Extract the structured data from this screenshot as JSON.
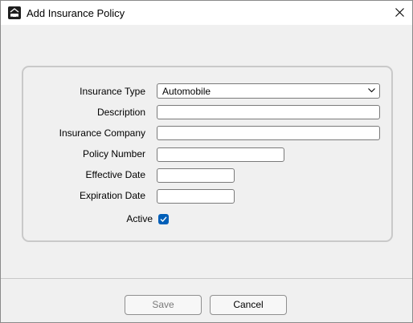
{
  "window": {
    "title": "Add Insurance Policy",
    "app_icon": "car-key-icon",
    "close_icon": "close-icon"
  },
  "form": {
    "insurance_type": {
      "label": "Insurance Type",
      "value": "Automobile"
    },
    "description": {
      "label": "Description",
      "value": ""
    },
    "insurance_company": {
      "label": "Insurance Company",
      "value": ""
    },
    "policy_number": {
      "label": "Policy Number",
      "value": ""
    },
    "effective_date": {
      "label": "Effective Date",
      "value": ""
    },
    "expiration_date": {
      "label": "Expiration Date",
      "value": ""
    },
    "active": {
      "label": "Active",
      "checked": true
    }
  },
  "buttons": {
    "save_label": "Save",
    "cancel_label": "Cancel"
  },
  "colors": {
    "accent": "#005fb8",
    "window_bg": "#f0f0f0",
    "titlebar_bg": "#ffffff"
  }
}
